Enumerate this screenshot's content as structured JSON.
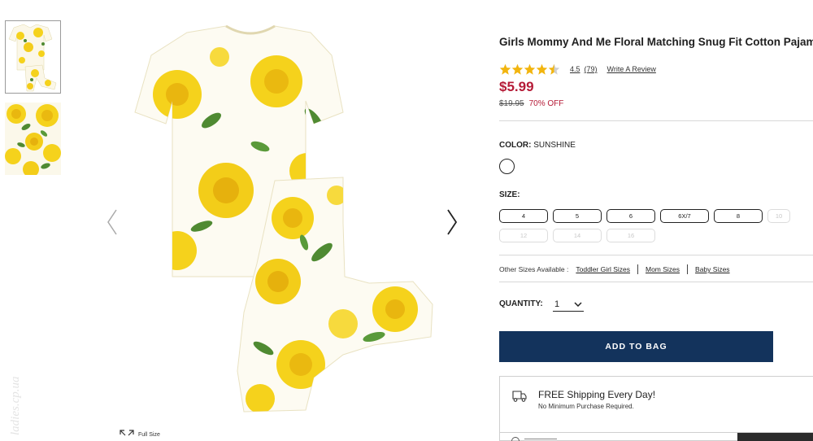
{
  "product": {
    "title": "Girls Mommy And Me Floral Matching Snug Fit Cotton Pajamas",
    "rating": "4.5",
    "review_count": "(79)",
    "write_review_label": "Write A Review",
    "stars_filled": 4.5,
    "price": "$5.99",
    "original_price": "$19.95",
    "discount": "70% OFF"
  },
  "color": {
    "label": "COLOR:",
    "value": "SUNSHINE"
  },
  "size": {
    "label": "SIZE:",
    "options": [
      {
        "label": "4",
        "available": true
      },
      {
        "label": "5",
        "available": true
      },
      {
        "label": "6",
        "available": true
      },
      {
        "label": "6X/7",
        "available": true
      },
      {
        "label": "8",
        "available": true
      },
      {
        "label": "10",
        "available": false
      },
      {
        "label": "12",
        "available": false
      },
      {
        "label": "14",
        "available": false
      },
      {
        "label": "16",
        "available": false
      }
    ]
  },
  "other_sizes": {
    "label": "Other Sizes Available :",
    "links": [
      "Toddler Girl Sizes",
      "Mom Sizes",
      "Baby Sizes"
    ]
  },
  "quantity": {
    "label": "QUANTITY:",
    "value": "1"
  },
  "add_to_bag_label": "ADD TO BAG",
  "shipping": {
    "title": "FREE Shipping Every Day!",
    "subtitle": "No Minimum Purchase Required."
  },
  "gallery": {
    "full_size_label": "Full Size"
  },
  "colors": {
    "price_red": "#b51b37",
    "button_navy": "#13335c",
    "star_gold": "#f2b50f",
    "print_yellow": "#f5d21c",
    "leaf_green": "#4f8a32"
  }
}
